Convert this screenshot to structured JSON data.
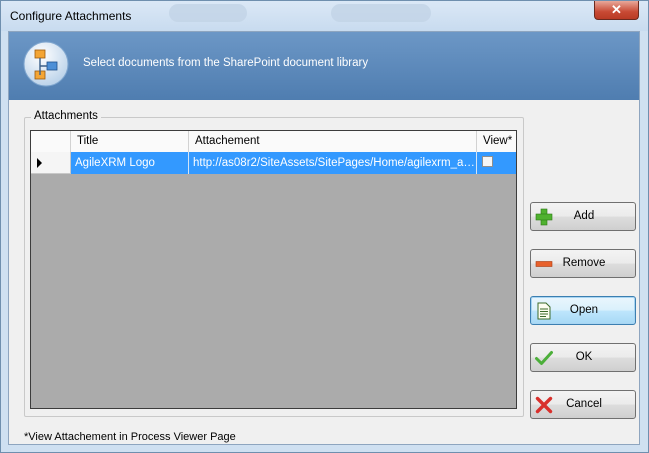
{
  "window": {
    "title": "Configure Attachments",
    "close_label": "✕"
  },
  "banner": {
    "icon": "sitemap-icon",
    "text": "Select documents from the SharePoint document library"
  },
  "attachments": {
    "group_label": "Attachments",
    "columns": [
      "Title",
      "Attachement",
      "View*"
    ],
    "rows": [
      {
        "title": "AgileXRM Logo",
        "attachment": "http://as08r2/SiteAssets/SitePages/Home/agilexrm_agil...",
        "view": false
      }
    ]
  },
  "buttons": {
    "add": "Add",
    "remove": "Remove",
    "open": "Open",
    "ok": "OK",
    "cancel": "Cancel"
  },
  "footnote": "*View Attachement in Process Viewer Page",
  "colors": {
    "banner": "#5b88ba",
    "selection": "#3399ff",
    "grid_background": "#ababab"
  }
}
